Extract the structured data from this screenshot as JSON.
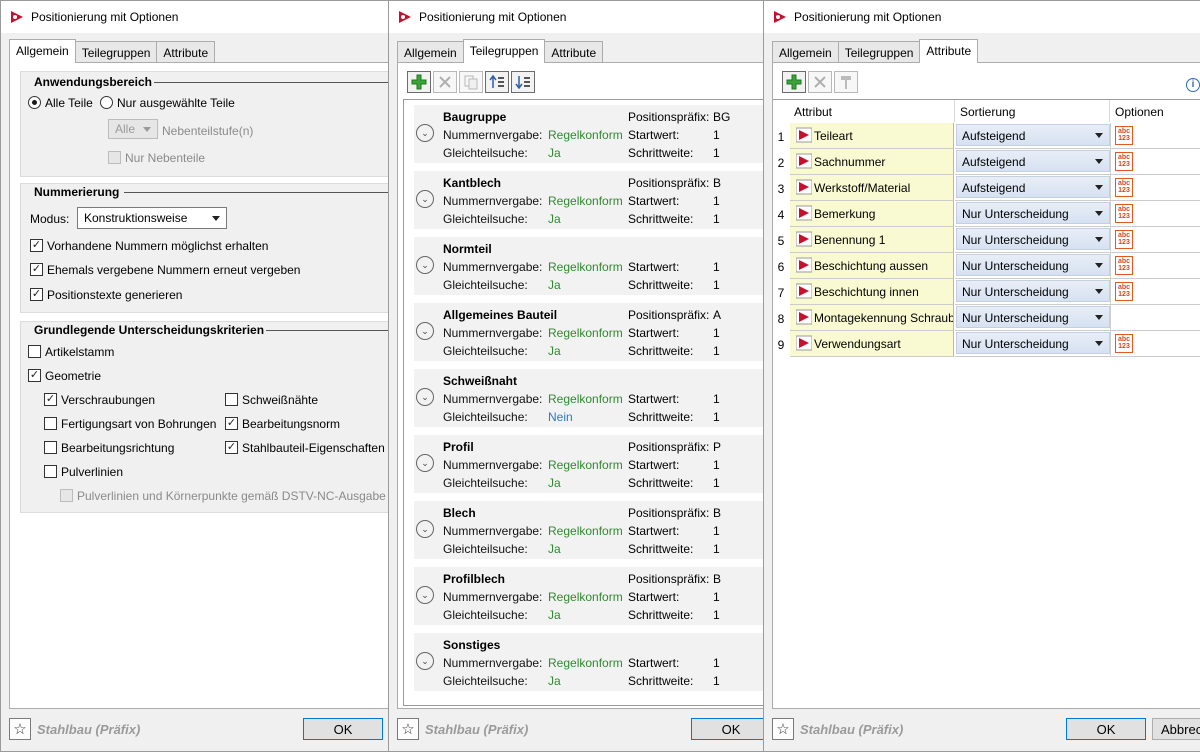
{
  "windows": {
    "w1": {
      "title": "Positionierung mit Optionen",
      "tabs": [
        "Allgemein",
        "Teilegruppen",
        "Attribute"
      ],
      "anwendungsbereich": {
        "title": "Anwendungsbereich",
        "radio_all": "Alle Teile",
        "radio_selected": "Nur ausgewählte Teile",
        "level_combo": "Alle",
        "level_label": "Nebenteilstufe(n)",
        "only_sub": "Nur Nebenteile"
      },
      "nummerierung": {
        "title": "Nummerierung",
        "modus_label": "Modus:",
        "modus_value": "Konstruktionsweise",
        "opt1": "Vorhandene Nummern möglichst erhalten",
        "opt2": "Ehemals vergebene Nummern erneut vergeben",
        "opt3": "Positionstexte generieren"
      },
      "kriterien": {
        "title": "Grundlegende Unterscheidungskriterien",
        "artikelstamm": "Artikelstamm",
        "geometrie": "Geometrie",
        "verschraubungen": "Verschraubungen",
        "schweissnaehte": "Schweißnähte",
        "fertigungsart": "Fertigungsart von Bohrungen",
        "bearbeitungsnorm": "Bearbeitungsnorm",
        "bearbeitungsrichtung": "Bearbeitungsrichtung",
        "stahlbauteil": "Stahlbauteil-Eigenschaften",
        "pulverlinien": "Pulverlinien",
        "pulverlinien_dstv": "Pulverlinien und Körnerpunkte gemäß DSTV-NC-Ausgabe"
      },
      "preset": "Stahlbau (Präfix)",
      "ok": "OK"
    },
    "w2": {
      "title": "Positionierung mit Optionen",
      "tabs": [
        "Allgemein",
        "Teilegruppen",
        "Attribute"
      ],
      "labels": {
        "numvergabe": "Nummernvergabe:",
        "gleichteil": "Gleichteilsuche:",
        "prefix": "Positionspräfix:",
        "start": "Startwert:",
        "step": "Schrittweite:"
      },
      "groups": [
        {
          "name": "Baugruppe",
          "prefix": "BG",
          "vergabe": "Regelkonform",
          "suche": "Ja",
          "start": "1",
          "step": "1"
        },
        {
          "name": "Kantblech",
          "prefix": "B",
          "vergabe": "Regelkonform",
          "suche": "Ja",
          "start": "1",
          "step": "1"
        },
        {
          "name": "Normteil",
          "prefix": "",
          "vergabe": "Regelkonform",
          "suche": "Ja",
          "start": "1",
          "step": "1"
        },
        {
          "name": "Allgemeines Bauteil",
          "prefix": "A",
          "vergabe": "Regelkonform",
          "suche": "Ja",
          "start": "1",
          "step": "1"
        },
        {
          "name": "Schweißnaht",
          "prefix": "",
          "vergabe": "Regelkonform",
          "suche": "Nein",
          "start": "1",
          "step": "1"
        },
        {
          "name": "Profil",
          "prefix": "P",
          "vergabe": "Regelkonform",
          "suche": "Ja",
          "start": "1",
          "step": "1"
        },
        {
          "name": "Blech",
          "prefix": "B",
          "vergabe": "Regelkonform",
          "suche": "Ja",
          "start": "1",
          "step": "1"
        },
        {
          "name": "Profilblech",
          "prefix": "B",
          "vergabe": "Regelkonform",
          "suche": "Ja",
          "start": "1",
          "step": "1"
        },
        {
          "name": "Sonstiges",
          "prefix": "",
          "vergabe": "Regelkonform",
          "suche": "Ja",
          "start": "1",
          "step": "1"
        }
      ],
      "preset": "Stahlbau (Präfix)",
      "ok": "OK"
    },
    "w3": {
      "title": "Positionierung mit Optionen",
      "tabs": [
        "Allgemein",
        "Teilegruppen",
        "Attribute"
      ],
      "columns": [
        "Attribut",
        "Sortierung",
        "Optionen"
      ],
      "rows": [
        {
          "n": "1",
          "attr": "Teileart",
          "sort": "Aufsteigend",
          "opt": true
        },
        {
          "n": "2",
          "attr": "Sachnummer",
          "sort": "Aufsteigend",
          "opt": true
        },
        {
          "n": "3",
          "attr": "Werkstoff/Material",
          "sort": "Aufsteigend",
          "opt": true
        },
        {
          "n": "4",
          "attr": "Bemerkung",
          "sort": "Nur Unterscheidung",
          "opt": true
        },
        {
          "n": "5",
          "attr": "Benennung 1",
          "sort": "Nur Unterscheidung",
          "opt": true
        },
        {
          "n": "6",
          "attr": "Beschichtung aussen",
          "sort": "Nur Unterscheidung",
          "opt": true
        },
        {
          "n": "7",
          "attr": "Beschichtung innen",
          "sort": "Nur Unterscheidung",
          "opt": true
        },
        {
          "n": "8",
          "attr": "Montagekennung Schraube",
          "sort": "Nur Unterscheidung",
          "opt": false
        },
        {
          "n": "9",
          "attr": "Verwendungsart",
          "sort": "Nur Unterscheidung",
          "opt": true
        }
      ],
      "preset": "Stahlbau (Präfix)",
      "ok": "OK",
      "cancel": "Abbrechen",
      "cancel_visible": "Abbrec"
    }
  },
  "colors": {
    "accent": "#0078d7",
    "green_value": "#2f8a2f",
    "blue_value": "#2a7ac8",
    "attr_bg": "#fafad2"
  }
}
